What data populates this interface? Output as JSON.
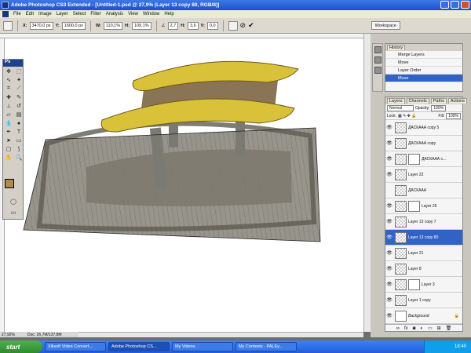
{
  "window": {
    "title": "Adobe Photoshop CS3 Extended - [Untitled-1.psd @ 27,9% (Layer 13 copy 80, RGB/8)]"
  },
  "menu": [
    "File",
    "Edit",
    "Image",
    "Layer",
    "Select",
    "Filter",
    "Analysis",
    "View",
    "Window",
    "Help"
  ],
  "options": {
    "x_label": "X:",
    "x": "3470,0 px",
    "y_label": "Y:",
    "y": "1600,0 px",
    "w_label": "W:",
    "w": "110,1%",
    "h_label": "H:",
    "h": "109,1%",
    "angle": "2,7",
    "skew_h_label": "H:",
    "skew_h": "3,6",
    "skew_v_label": "V:",
    "skew_v": "0,0",
    "workspace": "Workspace"
  },
  "toolbox": {
    "badge": "Ps",
    "foreground_color": "#b08a4a",
    "background_color": "#ffffff"
  },
  "history": {
    "tabs": [
      "History"
    ],
    "items": [
      {
        "label": "Merge Layers"
      },
      {
        "label": "Move"
      },
      {
        "label": "Layer Order"
      },
      {
        "label": "Move",
        "active": true
      }
    ]
  },
  "layers": {
    "tabs": [
      "Layers",
      "Channels",
      "Paths",
      "Actions"
    ],
    "blend_mode": "Normal",
    "opacity_label": "Opacity:",
    "opacity": "100%",
    "lock_label": "Lock:",
    "fill_label": "Fill:",
    "fill": "100%",
    "items": [
      {
        "name": "ДАСКААА copy 5",
        "visible": true
      },
      {
        "name": "ДАСКААА copy",
        "visible": true
      },
      {
        "name": "ДАСКААА c...",
        "visible": true,
        "mask": true
      },
      {
        "name": "Layer 22",
        "visible": true
      },
      {
        "name": "ДАСКААА",
        "visible": false
      },
      {
        "name": "Layer 25",
        "visible": true,
        "mask": true
      },
      {
        "name": "Layer 13 copy 7",
        "visible": true
      },
      {
        "name": "Layer 13 copy 80",
        "visible": true,
        "selected": true
      },
      {
        "name": "Layer 21",
        "visible": true
      },
      {
        "name": "Layer 8",
        "visible": true
      },
      {
        "name": "Layer 3",
        "visible": true,
        "mask": true
      },
      {
        "name": "Layer 1 copy",
        "visible": true
      },
      {
        "name": "Background",
        "visible": true,
        "locked": true
      }
    ]
  },
  "status": {
    "zoom": "27,92%",
    "doc": "Doc: 26,7M/137,8M"
  },
  "taskbar": {
    "start": "start",
    "tasks": [
      "Xilisoft Video Convert...",
      "Adobe Photoshop CS...",
      "My Videos",
      "My Contests - PALEy..."
    ],
    "clock": "18:40"
  },
  "colors": {
    "accent": "#3163c5",
    "banana": "#d9c13a",
    "wood": "#8e8a80"
  }
}
